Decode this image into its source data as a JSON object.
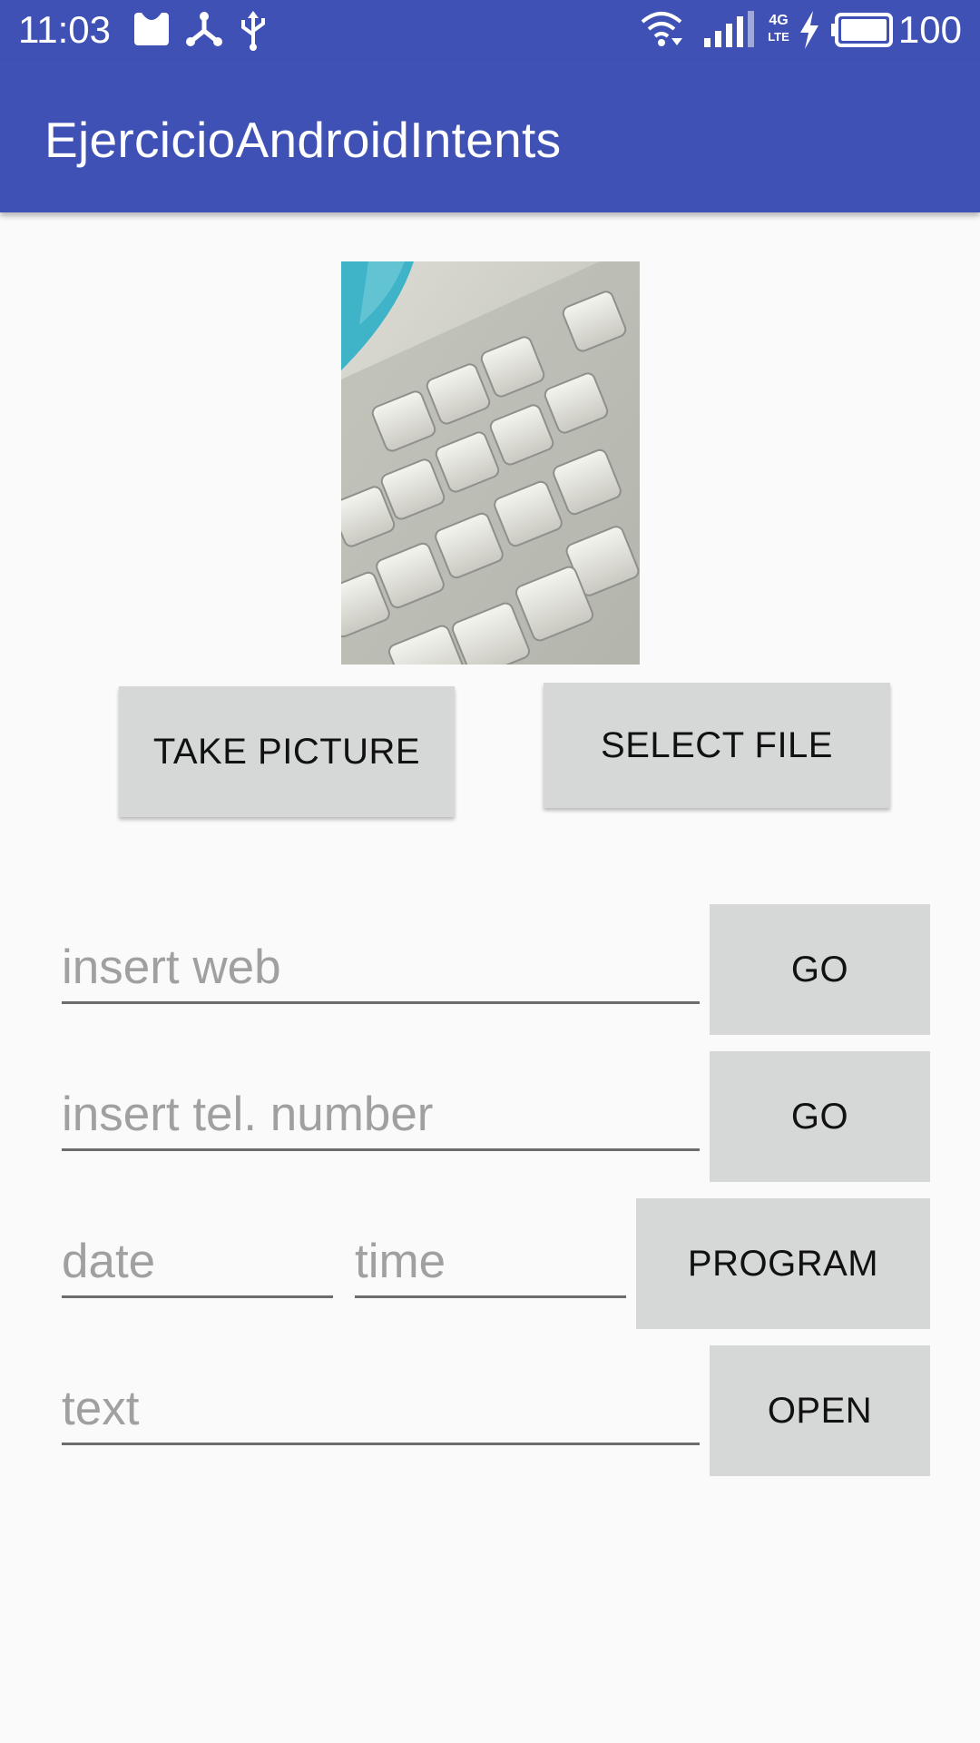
{
  "status_bar": {
    "time": "11:03",
    "battery_percent": "100",
    "network_label": "4G",
    "network_sub": "LTE",
    "icons": [
      "message-icon",
      "share-icon",
      "usb-icon",
      "wifi-icon",
      "signal-icon",
      "charging-icon",
      "battery-icon"
    ]
  },
  "app_bar": {
    "title": "EjercicioAndroidIntents",
    "color": "#3f51b5"
  },
  "photo": {
    "icon": "keyboard-photo"
  },
  "buttons": {
    "take_picture": "TAKE PICTURE",
    "select_file": "SELECT FILE",
    "go_web": "GO",
    "go_tel": "GO",
    "program": "PROGRAM",
    "open": "OPEN"
  },
  "inputs": {
    "web": {
      "value": "",
      "placeholder": "insert web"
    },
    "tel": {
      "value": "",
      "placeholder": "insert tel. number"
    },
    "date": {
      "value": "",
      "placeholder": "date"
    },
    "time": {
      "value": "",
      "placeholder": "time"
    },
    "text": {
      "value": "",
      "placeholder": "text"
    }
  }
}
